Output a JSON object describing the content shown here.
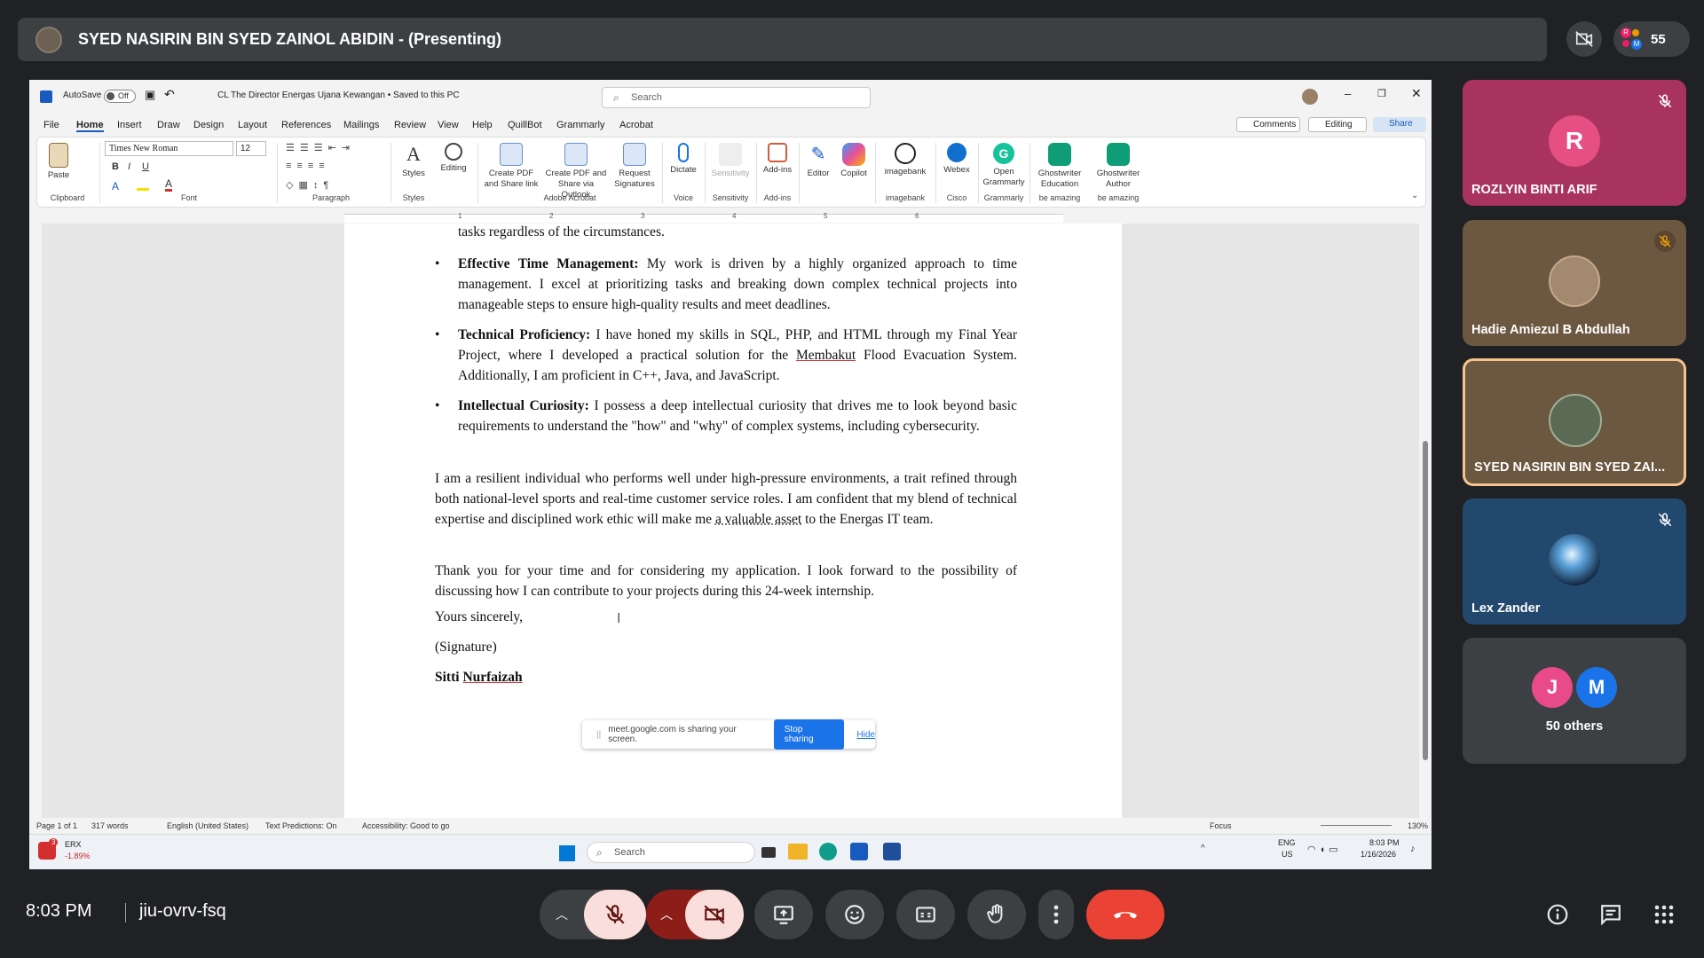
{
  "presenter_bar": {
    "title": "SYED NASIRIN BIN SYED ZAINOL ABIDIN - (Presenting)"
  },
  "top_right": {
    "participant_count": "55",
    "badge_letters": [
      "R",
      "M"
    ]
  },
  "word": {
    "autosave_label": "AutoSave",
    "autosave_state": "Off",
    "doc_title": "CL The Director Energas Ujana Kewangan • Saved to this PC",
    "search_placeholder": "Search",
    "menus": [
      "File",
      "Home",
      "Insert",
      "Draw",
      "Design",
      "Layout",
      "References",
      "Mailings",
      "Review",
      "View",
      "Help",
      "QuillBot",
      "Grammarly",
      "Acrobat"
    ],
    "comments_label": "Comments",
    "editing_label": "Editing",
    "share_label": "Share",
    "font_name": "Times New Roman",
    "font_size": "12",
    "ribbon_buttons": {
      "paste": "Paste",
      "styles": "Styles",
      "editing": "Editing",
      "create_pdf": "Create PDF and Share link",
      "create_pdf_outlook": "Create PDF and Share via Outlook",
      "request_sig": "Request Signatures",
      "dictate": "Dictate",
      "sensitivity": "Sensitivity",
      "addins": "Add-ins",
      "editor": "Editor",
      "copilot": "Copilot",
      "imagebank": "imagebank",
      "webex": "Webex",
      "open_grammarly": "Open Grammarly",
      "gw_education": "Ghostwriter Education",
      "gw_author": "Ghostwriter Author"
    },
    "ribbon_groups": {
      "clipboard": "Clipboard",
      "font": "Font",
      "paragraph": "Paragraph",
      "styles": "Styles",
      "adobe": "Adobe Acrobat",
      "voice": "Voice",
      "sensitivity": "Sensitivity",
      "addins": "Add-ins",
      "imagebank": "imagebank",
      "cisco": "Cisco",
      "grammarly": "Grammarly",
      "amazing1": "be amazing",
      "amazing2": "be amazing"
    },
    "ruler_numbers": [
      "1",
      "2",
      "3",
      "4",
      "5",
      "6"
    ],
    "document": {
      "line0": "tasks regardless of the circumstances.",
      "b1_head": "Effective Time Management:",
      "b1_body": " My work is driven by a highly organized approach to time management. I excel at prioritizing tasks and breaking down complex technical projects into manageable steps to ensure high-quality results and meet deadlines.",
      "b2_head": "Technical Proficiency:",
      "b2_body_a": " I have honed my skills in SQL, PHP, and HTML through my Final Year Project, where I developed a practical solution for the ",
      "b2_underlined": "Membakut",
      "b2_body_b": " Flood Evacuation System. Additionally, I am proficient in C++, Java, and JavaScript.",
      "b3_head": "Intellectual Curiosity:",
      "b3_body": " I possess a deep intellectual curiosity that drives me to look beyond basic requirements to understand the \"how\" and \"why\" of complex systems, including cybersecurity.",
      "p1_a": "I am a resilient individual who performs well under high-pressure environments, a trait refined through both national-level sports and real-time customer service roles. I am confident that my blend of technical expertise and disciplined work ethic will make me ",
      "p1_underlined": "a valuable asset",
      "p1_b": " to the Energas IT team.",
      "p2": "Thank you for your time and for considering my application. I look forward to the possibility of discussing how I can contribute to your projects during this 24-week internship.",
      "closing": "Yours sincerely,",
      "signature": "(Signature)",
      "sign_first": "Sitti ",
      "sign_last": "Nurfaizah"
    },
    "share_toast": {
      "text": "meet.google.com is sharing your screen.",
      "stop": "Stop sharing",
      "hide": "Hide"
    },
    "status": {
      "page": "Page 1 of 1",
      "words": "317 words",
      "language": "English (United States)",
      "predictions": "Text Predictions: On",
      "accessibility": "Accessibility: Good to go",
      "focus": "Focus",
      "zoom": "130%"
    },
    "taskbar": {
      "stock_name": "ERX",
      "stock_change": "-1.89%",
      "stock_badge": "3",
      "search": "Search",
      "lang": "ENG",
      "region": "US",
      "time": "8:03 PM",
      "date": "1/16/2026"
    }
  },
  "participants": [
    {
      "name": "ROZLYIN BINTI ARIF",
      "initial": "R",
      "muted": true,
      "color": "#c5336e"
    },
    {
      "name": "Hadie Amiezul B Abdullah",
      "muted": true
    },
    {
      "name": "SYED NASIRIN BIN SYED ZAI...",
      "muted": false
    },
    {
      "name": "Lex Zander",
      "muted": true
    },
    {
      "name": "50 others",
      "initials": [
        "J",
        "M"
      ]
    }
  ],
  "bottom": {
    "time": "8:03 PM",
    "meeting_code": "jiu-ovrv-fsq"
  },
  "colors": {
    "end_call": "#ea4335",
    "muted_mic": "#f9dedc",
    "cam_off": "#8c1d18",
    "accent_blue": "#1a73e8"
  }
}
